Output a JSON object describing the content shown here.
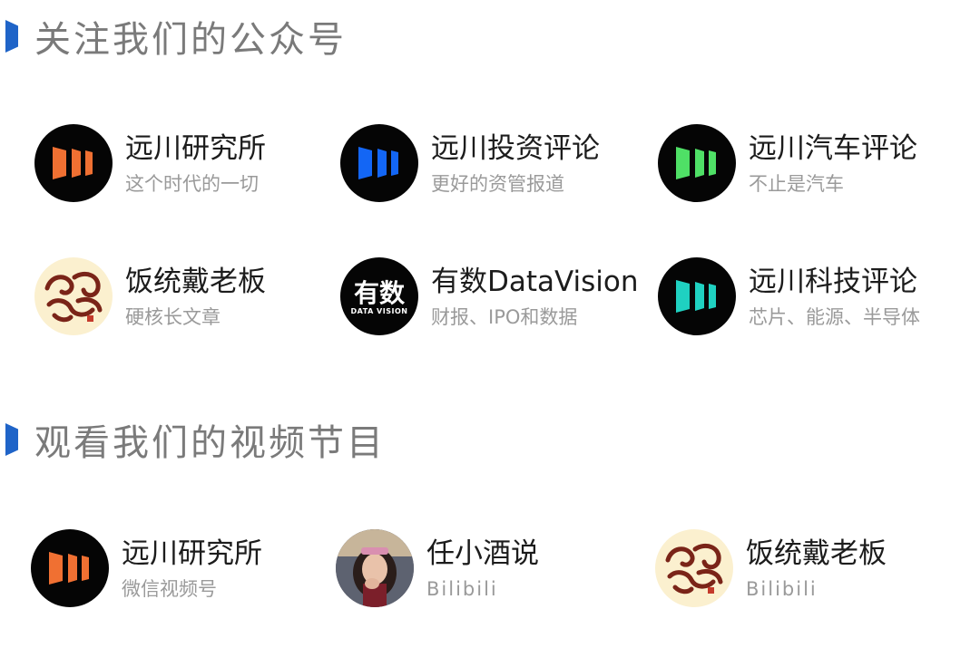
{
  "section_follow": {
    "title": "关注我们的公众号"
  },
  "section_video": {
    "title": "观看我们的视频节目"
  },
  "accent_color": "#1f64c8",
  "accounts": [
    {
      "name": "远川研究所",
      "desc": "这个时代的一切",
      "icon": "yuanchuan-logo-orange",
      "color": "#f07032"
    },
    {
      "name": "远川投资评论",
      "desc": "更好的资管报道",
      "icon": "yuanchuan-logo-blue",
      "color": "#1366f5"
    },
    {
      "name": "远川汽车评论",
      "desc": "不止是汽车",
      "icon": "yuanchuan-logo-green",
      "color": "#4fe066"
    },
    {
      "name": "饭统戴老板",
      "desc": "硬核长文章",
      "icon": "dragon-logo"
    },
    {
      "name": "有数DataVision",
      "desc": "财报、IPO和数据",
      "icon": "datavision-logo",
      "logo_text": "有数",
      "logo_sub": "DATA VISION"
    },
    {
      "name": "远川科技评论",
      "desc": "芯片、能源、半导体",
      "icon": "yuanchuan-logo-teal",
      "color": "#1fd1c1"
    }
  ],
  "videos": [
    {
      "name": "远川研究所",
      "desc": "微信视频号",
      "icon": "yuanchuan-logo-orange",
      "color": "#f07032"
    },
    {
      "name": "任小酒说",
      "desc": "Bilibili",
      "icon": "person-avatar"
    },
    {
      "name": "饭统戴老板",
      "desc": "Bilibili",
      "icon": "dragon-logo"
    }
  ]
}
